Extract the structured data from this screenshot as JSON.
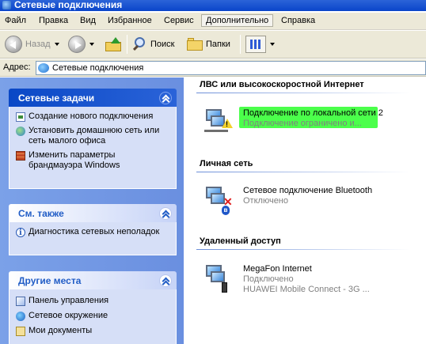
{
  "window": {
    "title": "Сетевые подключения"
  },
  "menu": [
    "Файл",
    "Правка",
    "Вид",
    "Избранное",
    "Сервис",
    "Дополнительно",
    "Справка"
  ],
  "menu_active_index": 5,
  "toolbar": {
    "back_label": "Назад",
    "search_label": "Поиск",
    "folders_label": "Папки"
  },
  "address": {
    "label": "Адрес:",
    "value": "Сетевые подключения"
  },
  "tasks_panel": {
    "title": "Сетевые задачи",
    "items": [
      {
        "label": "Создание нового подключения",
        "icon": "new-connection-icon"
      },
      {
        "label": "Установить домашнюю сеть или сеть малого офиса",
        "icon": "home-network-icon"
      },
      {
        "label": "Изменить параметры брандмауэра Windows",
        "icon": "firewall-icon"
      }
    ]
  },
  "see_also_panel": {
    "title": "См. также",
    "items": [
      {
        "label": "Диагностика сетевых неполадок",
        "icon": "info-icon"
      }
    ]
  },
  "other_places_panel": {
    "title": "Другие места",
    "items": [
      {
        "label": "Панель управления",
        "icon": "control-panel-icon"
      },
      {
        "label": "Сетевое окружение",
        "icon": "network-places-icon"
      },
      {
        "label": "Мои документы",
        "icon": "my-documents-icon"
      }
    ]
  },
  "groups": [
    {
      "title": "ЛВС или высокоскоростной Интернет",
      "items": [
        {
          "name": "Подключение по локальной сети 2",
          "status": "Подключение ограничено и...",
          "highlighted": true,
          "icon": "lan-warning-icon"
        }
      ]
    },
    {
      "title": "Личная сеть",
      "items": [
        {
          "name": "Сетевое подключение Bluetooth",
          "status": "Отключено",
          "icon": "bluetooth-connection-icon"
        }
      ]
    },
    {
      "title": "Удаленный доступ",
      "items": [
        {
          "name": "MegaFon Internet",
          "status": "Подключено",
          "device": "HUAWEI Mobile Connect - 3G ...",
          "icon": "dialup-modem-icon"
        }
      ]
    }
  ],
  "colors": {
    "highlight": "#2bff2b",
    "task_pane_bg": "#7ba1e8",
    "panel_header_blue": "#0a48c6"
  }
}
